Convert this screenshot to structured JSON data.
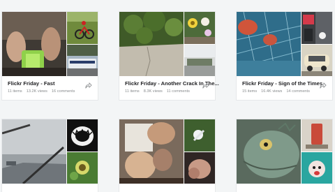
{
  "albums": [
    {
      "title": "Flickr Friday - Fast",
      "items": "11 items",
      "views": "13.2K views",
      "comments": "16 comments",
      "share_icon": "share-icon"
    },
    {
      "title": "Flickr Friday - Another Crack In The...",
      "items": "11 items",
      "views": "8.3K views",
      "comments": "11 comments",
      "share_icon": "share-icon"
    },
    {
      "title": "Flickr Friday - Sign of the Times",
      "items": "15 items",
      "views": "16.4K views",
      "comments": "14 comments",
      "share_icon": "share-icon"
    },
    {},
    {},
    {}
  ],
  "colors": {
    "page_background": "#f3f5f6",
    "card_background": "#ffffff",
    "title_text": "#212124",
    "meta_text": "#898c8e"
  }
}
